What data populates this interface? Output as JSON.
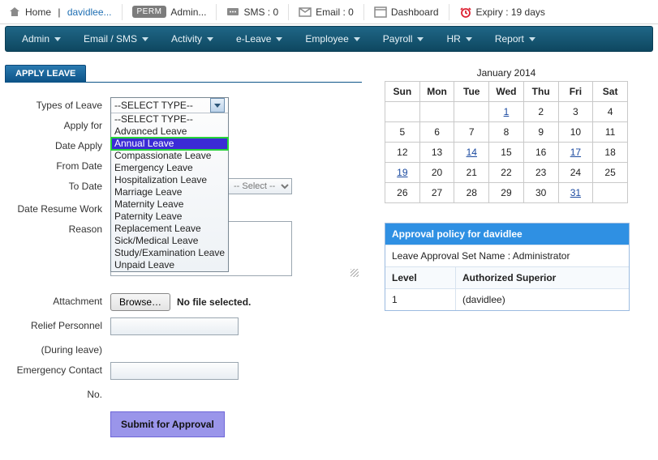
{
  "topbar": {
    "home_label": "Home",
    "user_link": "davidlee...",
    "perm_badge": "PERM",
    "admin_label": "Admin...",
    "sms_label": "SMS : 0",
    "email_label": "Email : 0",
    "dashboard_label": "Dashboard",
    "expiry_label": "Expiry : 19 days"
  },
  "nav": {
    "items": [
      "Admin",
      "Email / SMS",
      "Activity",
      "e-Leave",
      "Employee",
      "Payroll",
      "HR",
      "Report"
    ]
  },
  "panel": {
    "title": "APPLY LEAVE",
    "labels": {
      "types": "Types of Leave",
      "apply_for": "Apply for",
      "date_apply": "Date Apply",
      "from_date": "From Date",
      "to_date": "To Date",
      "resume": "Date Resume Work",
      "reason": "Reason",
      "attachment": "Attachment",
      "relief": "Relief Personnel",
      "during": "(During leave)",
      "emergency": "Emergency Contact",
      "no": "No.",
      "submit": "Submit for Approval",
      "browse": "Browse…",
      "no_file": "No file selected.",
      "time_placeholder": "-- Select --"
    },
    "type_selected_head": "--SELECT TYPE--",
    "type_highlight": "Annual Leave",
    "type_options": [
      "--SELECT TYPE--",
      "Advanced Leave",
      "Annual Leave",
      "Compassionate Leave",
      "Emergency Leave",
      "Hospitalization Leave",
      "Marriage Leave",
      "Maternity Leave",
      "Paternity Leave",
      "Replacement Leave",
      "Sick/Medical Leave",
      "Study/Examination Leave",
      "Unpaid Leave"
    ]
  },
  "calendar": {
    "title": "January 2014",
    "dow": [
      "Sun",
      "Mon",
      "Tue",
      "Wed",
      "Thu",
      "Fri",
      "Sat"
    ],
    "weeks": [
      [
        {
          "t": ""
        },
        {
          "t": ""
        },
        {
          "t": ""
        },
        {
          "t": "1",
          "l": true
        },
        {
          "t": "2"
        },
        {
          "t": "3"
        },
        {
          "t": "4"
        }
      ],
      [
        {
          "t": "5"
        },
        {
          "t": "6"
        },
        {
          "t": "7"
        },
        {
          "t": "8"
        },
        {
          "t": "9"
        },
        {
          "t": "10"
        },
        {
          "t": "11"
        }
      ],
      [
        {
          "t": "12"
        },
        {
          "t": "13"
        },
        {
          "t": "14",
          "l": true
        },
        {
          "t": "15"
        },
        {
          "t": "16"
        },
        {
          "t": "17",
          "l": true
        },
        {
          "t": "18"
        }
      ],
      [
        {
          "t": "19",
          "l": true
        },
        {
          "t": "20"
        },
        {
          "t": "21"
        },
        {
          "t": "22"
        },
        {
          "t": "23"
        },
        {
          "t": "24"
        },
        {
          "t": "25"
        }
      ],
      [
        {
          "t": "26"
        },
        {
          "t": "27"
        },
        {
          "t": "28"
        },
        {
          "t": "29"
        },
        {
          "t": "30"
        },
        {
          "t": "31",
          "l": true
        },
        {
          "t": ""
        }
      ]
    ]
  },
  "policy": {
    "title": "Approval policy for davidlee",
    "set_name_label": "Leave Approval Set Name : Administrator",
    "col_level": "Level",
    "col_auth": "Authorized Superior",
    "rows": [
      {
        "level": "1",
        "auth": "(davidlee)"
      }
    ]
  }
}
